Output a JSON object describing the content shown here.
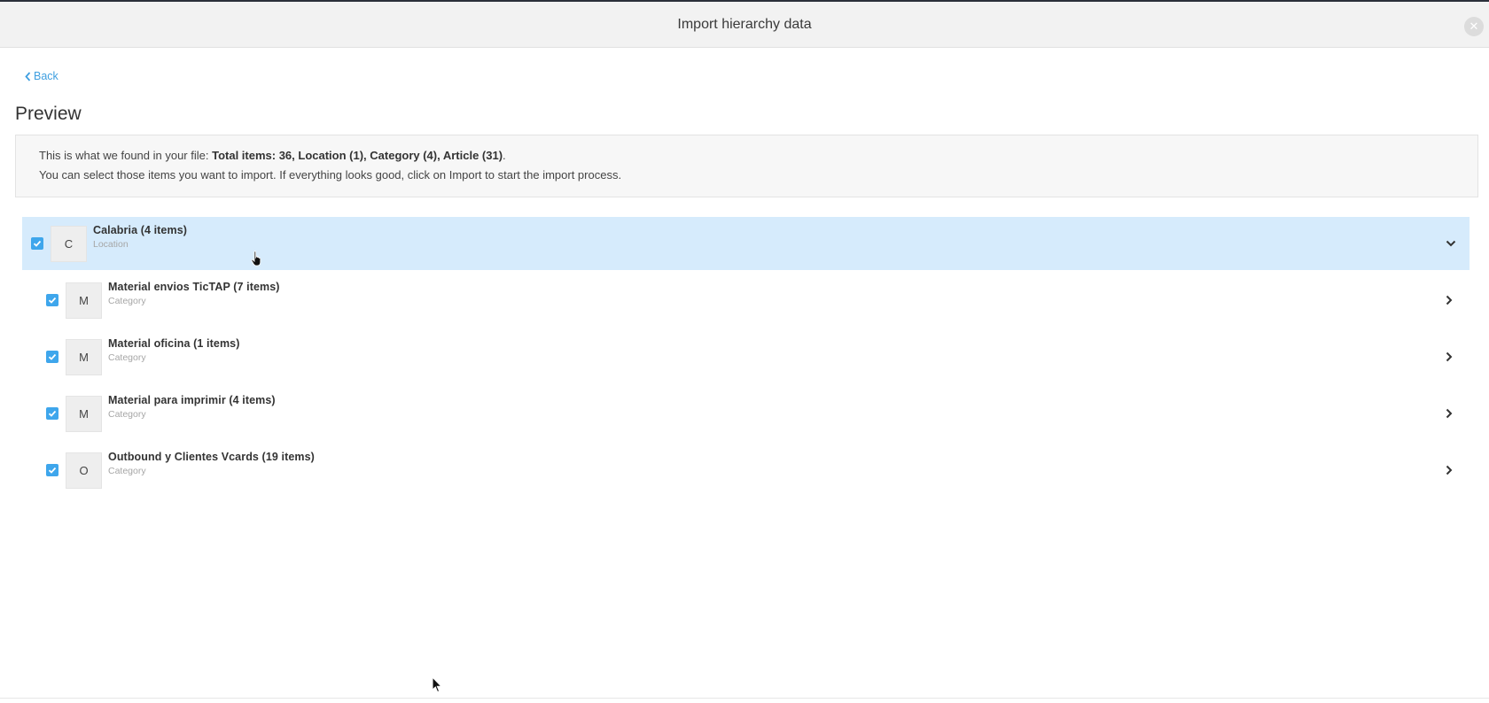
{
  "header": {
    "title": "Import hierarchy data",
    "close_icon": "close-icon"
  },
  "back": {
    "label": "Back",
    "icon": "chevron-left-icon"
  },
  "page_title": "Preview",
  "info": {
    "line1_prefix": "This is what we found in your file: ",
    "line1_bold": "Total items: 36, Location (1), Category (4), Article (31)",
    "line1_suffix": ".",
    "line2": "You can select those items you want to import. If everything looks good, click on Import to start the import process."
  },
  "accent_color": "#3ea6ec",
  "selected_row_color": "#d6ebfc",
  "tree": [
    {
      "letter": "C",
      "name": "Calabria (4 items)",
      "type": "Location",
      "checked": true,
      "expanded": true,
      "chevron_icon": "chevron-down-icon"
    },
    {
      "letter": "M",
      "name": "Material envios TicTAP (7 items)",
      "type": "Category",
      "checked": true,
      "expanded": false,
      "chevron_icon": "chevron-right-icon"
    },
    {
      "letter": "M",
      "name": "Material oficina (1 items)",
      "type": "Category",
      "checked": true,
      "expanded": false,
      "chevron_icon": "chevron-right-icon"
    },
    {
      "letter": "M",
      "name": "Material para imprimir (4 items)",
      "type": "Category",
      "checked": true,
      "expanded": false,
      "chevron_icon": "chevron-right-icon"
    },
    {
      "letter": "O",
      "name": "Outbound y Clientes Vcards (19 items)",
      "type": "Category",
      "checked": true,
      "expanded": false,
      "chevron_icon": "chevron-right-icon"
    }
  ]
}
